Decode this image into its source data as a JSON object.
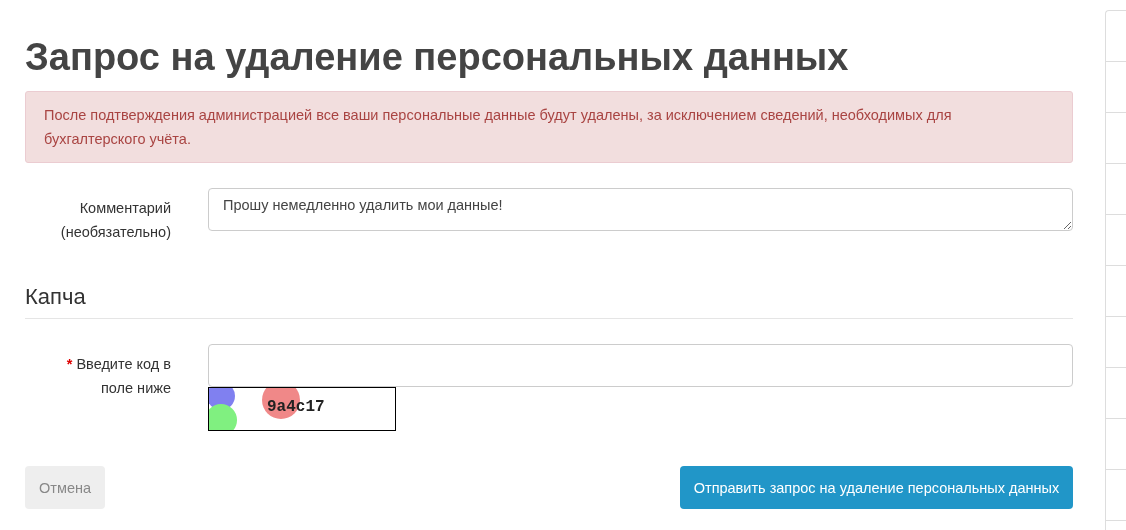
{
  "title": "Запрос на удаление персональных данных",
  "alert": "После подтверждения администрацией все ваши персональные данные будут удалены, за исключением сведений, необходимых для бухгалтерского учёта.",
  "comment_field": {
    "label": "Комментарий (необязательно)",
    "value": "Прошу немедленно удалить мои данные!"
  },
  "captcha_section": {
    "heading": "Капча",
    "required_mark": "*",
    "label": "Введите код в поле ниже",
    "code": "9a4c17"
  },
  "buttons": [
    {
      "kind": "secondary",
      "label": "Отмена"
    },
    {
      "kind": "primary",
      "label": "Отправить запрос на удаление персональных данных"
    }
  ]
}
